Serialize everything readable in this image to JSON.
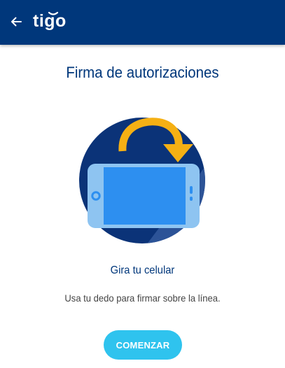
{
  "header": {
    "back_icon": "arrow-left-icon",
    "logo_text": "tigo",
    "brand_color": "#00377b"
  },
  "main": {
    "title": "Firma de autorizaciones",
    "illustration_icon": "rotate-phone-icon",
    "subtitle": "Gira tu celular",
    "description": "Usa tu dedo para firmar sobre la línea.",
    "start_button_label": "COMENZAR",
    "button_color": "#2fc3ee",
    "arrow_color": "#f5b014"
  }
}
